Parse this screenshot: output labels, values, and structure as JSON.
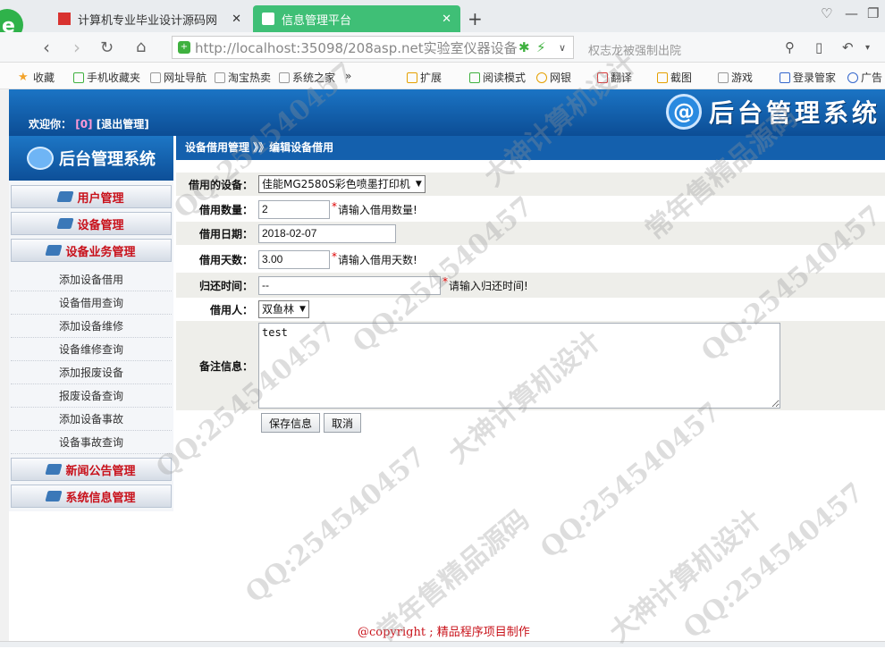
{
  "browser": {
    "tabs": [
      {
        "label": "计算机专业毕业设计源码网",
        "close": "✕"
      },
      {
        "label": "信息管理平台",
        "close": "✕"
      }
    ],
    "url": "http://localhost:35098/208asp.net实验室仪器设备",
    "search_hint": "权志龙被强制出院",
    "bookmarks": [
      "收藏",
      "手机收藏夹",
      "网址导航",
      "淘宝热卖",
      "系统之家",
      "»",
      "扩展",
      "阅读模式",
      "网银",
      "翻译",
      "截图",
      "游戏",
      "登录管家",
      "广告"
    ]
  },
  "header": {
    "welcome_label": "欢迎你：",
    "user": "[0]",
    "logout": "[退出管理]",
    "logo_mark": "@",
    "logo_text": "后台管理系统"
  },
  "sidebar": {
    "logo_text": "后台管理系统",
    "menus": [
      "用户管理",
      "设备管理",
      "设备业务管理",
      "新闻公告管理",
      "系统信息管理"
    ],
    "submenu": [
      "添加设备借用",
      "设备借用查询",
      "添加设备维修",
      "设备维修查询",
      "添加报废设备",
      "报废设备查询",
      "添加设备事故",
      "设备事故查询"
    ]
  },
  "content": {
    "breadcrumb": "设备借用管理 》》编辑设备借用",
    "form": {
      "device_label": "借用的设备：",
      "device_value": "佳能MG2580S彩色喷墨打印机",
      "qty_label": "借用数量：",
      "qty_value": "2",
      "qty_hint": "请输入借用数量!",
      "date_label": "借用日期：",
      "date_value": "2018-02-07",
      "days_label": "借用天数：",
      "days_value": "3.00",
      "days_hint": "请输入借用天数!",
      "return_label": "归还时间：",
      "return_value": "--",
      "return_hint": "请输入归还时间!",
      "borrower_label": "借用人：",
      "borrower_value": "双鱼林",
      "remark_label": "备注信息：",
      "remark_value": "test",
      "required_mark": "*",
      "save_label": "保存信息",
      "cancel_label": "取消"
    }
  },
  "footer": {
    "text": "@copyright ; 精品程序项目制作"
  },
  "watermarks": [
    "QQ:254540457",
    "大神计算机设计",
    "常年售精品源码"
  ],
  "colors": {
    "header_blue": "#1460ad",
    "active_tab": "#3fbf76",
    "menu_red": "#c8101a"
  }
}
